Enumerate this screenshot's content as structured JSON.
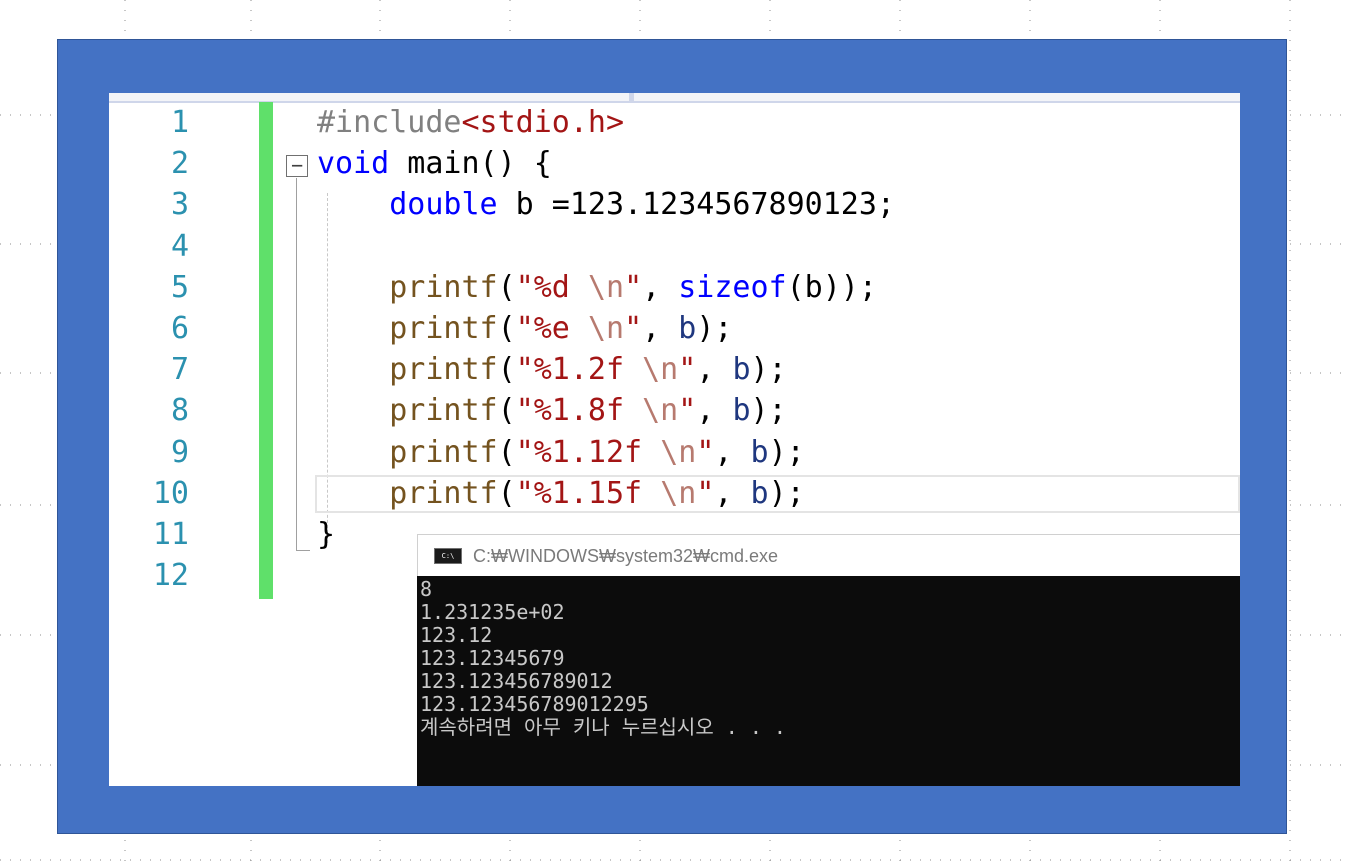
{
  "editor": {
    "lines": [
      {
        "num": "1",
        "tokens": [
          {
            "t": "#include",
            "c": "pp"
          },
          {
            "t": "<stdio.h>",
            "c": "inc"
          }
        ]
      },
      {
        "num": "2",
        "tokens": [
          {
            "t": "void",
            "c": "kw"
          },
          {
            "t": " main() {",
            "c": "op"
          }
        ]
      },
      {
        "num": "3",
        "tokens": [
          {
            "t": "    ",
            "c": "op"
          },
          {
            "t": "double",
            "c": "kw"
          },
          {
            "t": " b =123.1234567890123;",
            "c": "op"
          }
        ]
      },
      {
        "num": "4",
        "tokens": []
      },
      {
        "num": "5",
        "tokens": [
          {
            "t": "    ",
            "c": "op"
          },
          {
            "t": "printf",
            "c": "fn"
          },
          {
            "t": "(",
            "c": "op"
          },
          {
            "t": "\"%d ",
            "c": "str"
          },
          {
            "t": "\\n",
            "c": "esc"
          },
          {
            "t": "\"",
            "c": "str"
          },
          {
            "t": ", ",
            "c": "op"
          },
          {
            "t": "sizeof",
            "c": "kw"
          },
          {
            "t": "(b));",
            "c": "op"
          }
        ]
      },
      {
        "num": "6",
        "tokens": [
          {
            "t": "    ",
            "c": "op"
          },
          {
            "t": "printf",
            "c": "fn"
          },
          {
            "t": "(",
            "c": "op"
          },
          {
            "t": "\"%e ",
            "c": "str"
          },
          {
            "t": "\\n",
            "c": "esc"
          },
          {
            "t": "\"",
            "c": "str"
          },
          {
            "t": ", ",
            "c": "op"
          },
          {
            "t": "b",
            "c": "var"
          },
          {
            "t": ");",
            "c": "op"
          }
        ]
      },
      {
        "num": "7",
        "tokens": [
          {
            "t": "    ",
            "c": "op"
          },
          {
            "t": "printf",
            "c": "fn"
          },
          {
            "t": "(",
            "c": "op"
          },
          {
            "t": "\"%1.2f ",
            "c": "str"
          },
          {
            "t": "\\n",
            "c": "esc"
          },
          {
            "t": "\"",
            "c": "str"
          },
          {
            "t": ", ",
            "c": "op"
          },
          {
            "t": "b",
            "c": "var"
          },
          {
            "t": ");",
            "c": "op"
          }
        ]
      },
      {
        "num": "8",
        "tokens": [
          {
            "t": "    ",
            "c": "op"
          },
          {
            "t": "printf",
            "c": "fn"
          },
          {
            "t": "(",
            "c": "op"
          },
          {
            "t": "\"%1.8f ",
            "c": "str"
          },
          {
            "t": "\\n",
            "c": "esc"
          },
          {
            "t": "\"",
            "c": "str"
          },
          {
            "t": ", ",
            "c": "op"
          },
          {
            "t": "b",
            "c": "var"
          },
          {
            "t": ");",
            "c": "op"
          }
        ]
      },
      {
        "num": "9",
        "tokens": [
          {
            "t": "    ",
            "c": "op"
          },
          {
            "t": "printf",
            "c": "fn"
          },
          {
            "t": "(",
            "c": "op"
          },
          {
            "t": "\"%1.12f ",
            "c": "str"
          },
          {
            "t": "\\n",
            "c": "esc"
          },
          {
            "t": "\"",
            "c": "str"
          },
          {
            "t": ", ",
            "c": "op"
          },
          {
            "t": "b",
            "c": "var"
          },
          {
            "t": ");",
            "c": "op"
          }
        ]
      },
      {
        "num": "10",
        "tokens": [
          {
            "t": "    ",
            "c": "op"
          },
          {
            "t": "printf",
            "c": "fn"
          },
          {
            "t": "(",
            "c": "op"
          },
          {
            "t": "\"%1.15f ",
            "c": "str"
          },
          {
            "t": "\\n",
            "c": "esc"
          },
          {
            "t": "\"",
            "c": "str"
          },
          {
            "t": ", ",
            "c": "op"
          },
          {
            "t": "b",
            "c": "var"
          },
          {
            "t": ");",
            "c": "op"
          }
        ]
      },
      {
        "num": "11",
        "tokens": [
          {
            "t": "}",
            "c": "op"
          }
        ]
      },
      {
        "num": "12",
        "tokens": []
      }
    ],
    "fold_symbol": "−"
  },
  "console": {
    "title": "C:₩WINDOWS₩system32₩cmd.exe",
    "icon_label": "C:\\",
    "output": [
      "8",
      "1.231235e+02",
      "123.12",
      "123.12345679",
      "123.123456789012",
      "123.123456789012295",
      "계속하려면 아무 키나 누르십시오 . . ."
    ]
  },
  "colors": {
    "frame": "#4472c4",
    "change_bar": "#5fe06a",
    "line_numbers": "#2b91af",
    "keyword": "#0000ff",
    "string": "#a31515",
    "console_bg": "#0c0c0c"
  }
}
